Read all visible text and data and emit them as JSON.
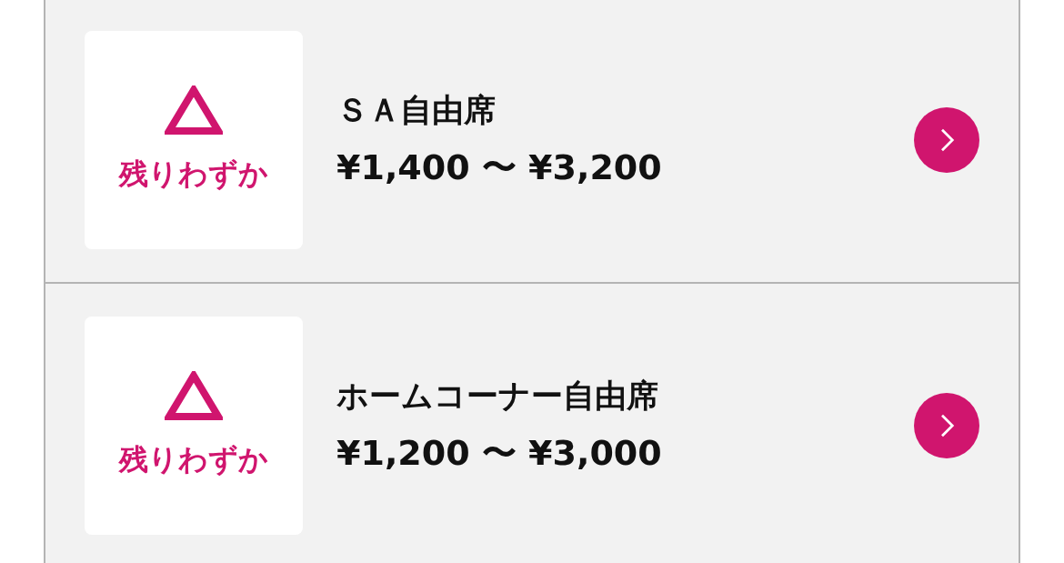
{
  "seat_types": [
    {
      "kind": "few",
      "availability_label": "残りわずか",
      "name": "ＳＡ自由席",
      "price": "¥1,400 〜 ¥3,200"
    },
    {
      "kind": "few",
      "availability_label": "残りわずか",
      "name": "ホームコーナー自由席",
      "price": "¥1,200 〜 ¥3,000"
    }
  ]
}
